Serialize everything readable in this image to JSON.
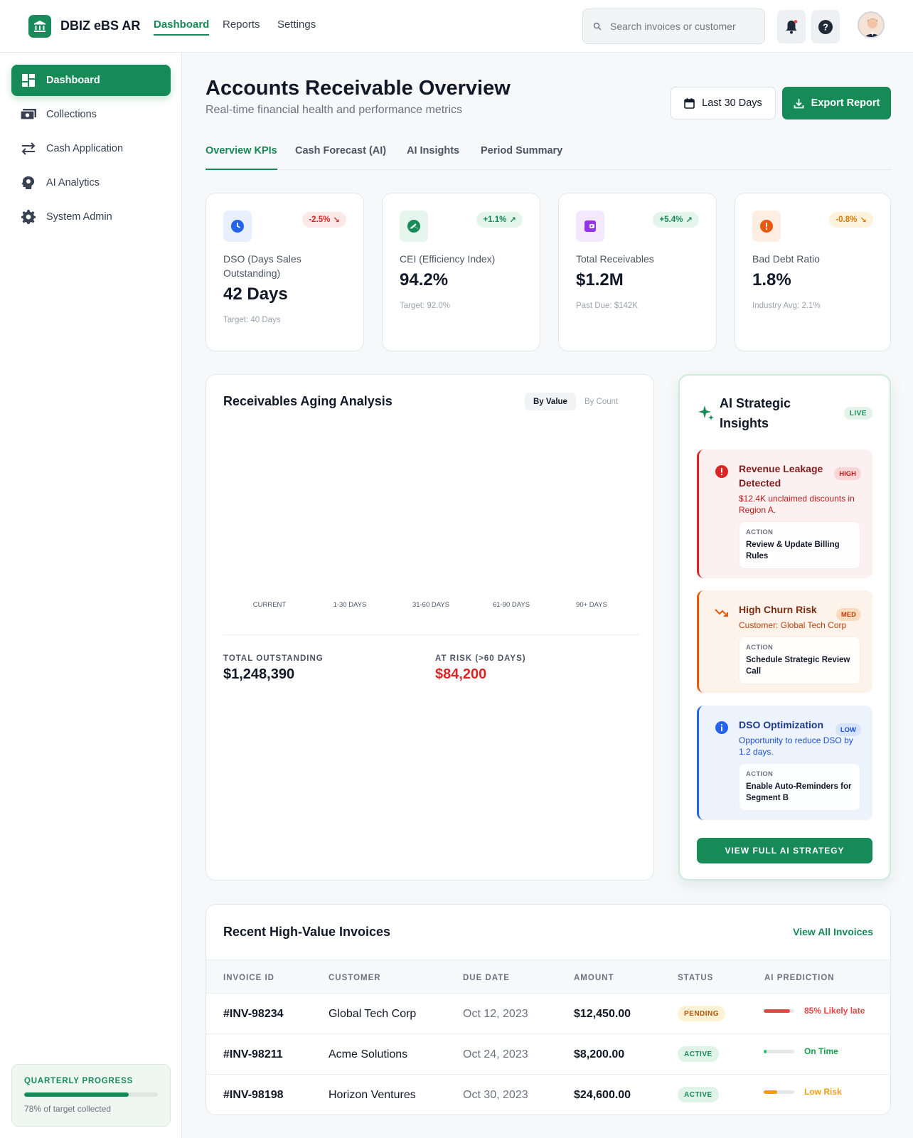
{
  "app": {
    "brand": "DBIZ eBS AR"
  },
  "topnav": {
    "items": [
      "Dashboard",
      "Reports",
      "Settings"
    ],
    "active": "Dashboard"
  },
  "search": {
    "placeholder": "Search invoices or customer"
  },
  "sidebar": {
    "items": [
      {
        "label": "Dashboard",
        "icon": "dashboard-icon"
      },
      {
        "label": "Collections",
        "icon": "money-icon"
      },
      {
        "label": "Cash Application",
        "icon": "swap-arrows-icon"
      },
      {
        "label": "AI Analytics",
        "icon": "brain-icon"
      },
      {
        "label": "System Admin",
        "icon": "gear-icon"
      }
    ],
    "progress": {
      "title": "QUARTERLY PROGRESS",
      "percent": 78,
      "text": "78% of target collected"
    }
  },
  "header": {
    "title": "Accounts Receivable Overview",
    "subtitle": "Real-time financial health and performance metrics",
    "date_button": "Last 30 Days",
    "export_button": "Export Report"
  },
  "tabs": [
    "Overview KPIs",
    "Cash Forecast (AI)",
    "AI Insights",
    "Period Summary"
  ],
  "kpis": [
    {
      "label": "DSO (Days Sales Outstanding)",
      "value": "42 Days",
      "badge": "-2.5%",
      "foot": "Target: 40 Days",
      "icon": "clock-icon",
      "color": "#2563eb"
    },
    {
      "label": "CEI (Efficiency Index)",
      "value": "94.2%",
      "badge": "+1.1%",
      "foot": "Target: 92.0%",
      "icon": "gauge-icon",
      "color": "#168a57"
    },
    {
      "label": "Total Receivables",
      "value": "$1.2M",
      "badge": "+5.4%",
      "foot": "Past Due: $142K",
      "icon": "wallet-icon",
      "color": "#9333ea"
    },
    {
      "label": "Bad Debt Ratio",
      "value": "1.8%",
      "badge": "-0.8%",
      "foot": "Industry Avg: 2.1%",
      "icon": "alert-icon",
      "color": "#ea580c"
    }
  ],
  "aging": {
    "title": "Receivables Aging Analysis",
    "toggle": [
      "By Value",
      "By Count"
    ],
    "categories": [
      "CURRENT",
      "1-30 DAYS",
      "31-60 DAYS",
      "61-90 DAYS",
      "90+ DAYS"
    ],
    "total_label": "TOTAL OUTSTANDING",
    "total_value": "$1,248,390",
    "risk_label": "AT RISK (>60 DAYS)",
    "risk_value": "$84,200"
  },
  "ai": {
    "title": "AI Strategic Insights",
    "live": "LIVE",
    "insights": [
      {
        "title": "Revenue Leakage Detected",
        "level": "HIGH",
        "desc": "$12.4K unclaimed discounts in Region A.",
        "action_label": "ACTION",
        "action": "Review & Update Billing Rules"
      },
      {
        "title": "High Churn Risk",
        "level": "MED",
        "desc": "Customer: Global Tech Corp",
        "action_label": "ACTION",
        "action": "Schedule Strategic Review Call"
      },
      {
        "title": "DSO Optimization",
        "level": "LOW",
        "desc": "Opportunity to reduce DSO by 1.2 days.",
        "action_label": "ACTION",
        "action": "Enable Auto-Reminders for Segment B"
      }
    ],
    "button": "VIEW FULL AI STRATEGY"
  },
  "invoices": {
    "title": "Recent High-Value Invoices",
    "link": "View All Invoices",
    "columns": [
      "INVOICE ID",
      "CUSTOMER",
      "DUE DATE",
      "AMOUNT",
      "STATUS",
      "AI PREDICTION"
    ],
    "rows": [
      {
        "id": "#INV-98234",
        "customer": "Global Tech Corp",
        "due": "Oct 12, 2023",
        "amount": "$12,450.00",
        "status": "PENDING",
        "prediction": "85% Likely late",
        "pred_level": 0.85,
        "pred_color": "#ef4444"
      },
      {
        "id": "#INV-98211",
        "customer": "Acme Solutions",
        "due": "Oct 24, 2023",
        "amount": "$8,200.00",
        "status": "ACTIVE",
        "prediction": "On Time",
        "pred_level": 0.1,
        "pred_color": "#22c55e"
      },
      {
        "id": "#INV-98198",
        "customer": "Horizon Ventures",
        "due": "Oct 30, 2023",
        "amount": "$24,600.00",
        "status": "ACTIVE",
        "prediction": "Low Risk",
        "pred_level": 0.45,
        "pred_color": "#f59e0b"
      }
    ]
  }
}
